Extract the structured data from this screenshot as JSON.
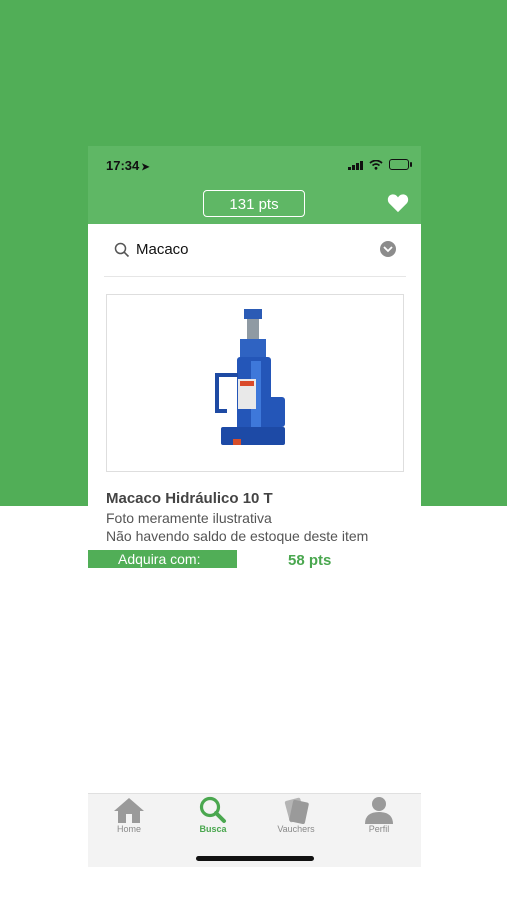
{
  "status_bar": {
    "time": "17:34"
  },
  "header": {
    "points": "131 pts"
  },
  "search": {
    "value": "Macaco"
  },
  "product": {
    "title": "Macaco Hidráulico 10 T",
    "note1": "Foto meramente ilustrativa",
    "note2": "Não havendo saldo de estoque deste item",
    "acquire_label": "Adquira com:",
    "price": "58 pts"
  },
  "tabs": [
    {
      "label": "Home",
      "icon": "home-icon"
    },
    {
      "label": "Busca",
      "icon": "search-icon"
    },
    {
      "label": "Vauchers",
      "icon": "voucher-icon"
    },
    {
      "label": "Perfil",
      "icon": "profile-icon"
    }
  ],
  "colors": {
    "brand_green": "#51ae57",
    "header_green": "#5fb765",
    "price_green": "#4aa74f"
  }
}
